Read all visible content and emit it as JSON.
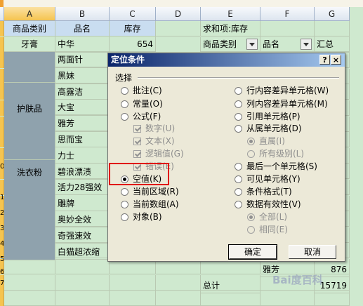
{
  "columns": [
    "A",
    "B",
    "C",
    "D",
    "E",
    "F",
    "G"
  ],
  "row_numbers": [
    "0",
    "1",
    "2",
    "3",
    "4",
    "5",
    "6",
    "7"
  ],
  "headers": {
    "a": "商品类别",
    "b": "品名",
    "c": "库存"
  },
  "rows": {
    "r1": {
      "a": "牙膏",
      "b": "中华",
      "c": "654"
    },
    "b_items": [
      "两面针",
      "黑妹",
      "高露洁",
      "大宝",
      "雅芳",
      "思而宝",
      "力士",
      "碧浪漂渍",
      "活力28强效",
      "雕牌",
      "奥妙全效",
      "奇强速效",
      "白猫超浓缩"
    ],
    "merged_a": [
      "护肤品",
      "洗衣粉"
    ]
  },
  "pivot": {
    "title": "求和项:库存",
    "field1": "商品类别",
    "field2": "品名",
    "total_col": "汇总",
    "row_yafang": "雅芳",
    "row_yafang_val": "876",
    "total_label": "总计",
    "total_val": "15719"
  },
  "dialog": {
    "title": "定位条件",
    "help": "?",
    "close": "×",
    "group": "选择",
    "left_options": [
      {
        "label": "批注(C)",
        "state": "off"
      },
      {
        "label": "常量(O)",
        "state": "off"
      },
      {
        "label": "公式(F)",
        "state": "off"
      },
      {
        "label": "数字(U)",
        "kind": "check"
      },
      {
        "label": "文本(X)",
        "kind": "check"
      },
      {
        "label": "逻辑值(G)",
        "kind": "check"
      },
      {
        "label": "错误(E)",
        "kind": "check"
      },
      {
        "label": "空值(K)",
        "state": "on"
      },
      {
        "label": "当前区域(R)",
        "state": "off"
      },
      {
        "label": "当前数组(A)",
        "state": "off"
      },
      {
        "label": "对象(B)",
        "state": "off"
      }
    ],
    "right_options": [
      {
        "label": "行内容差异单元格(W)",
        "state": "off"
      },
      {
        "label": "列内容差异单元格(M)",
        "state": "off"
      },
      {
        "label": "引用单元格(P)",
        "state": "off"
      },
      {
        "label": "从属单元格(D)",
        "state": "off"
      },
      {
        "label": "直属(I)",
        "state": "dis-on"
      },
      {
        "label": "所有级别(L)",
        "state": "dis"
      },
      {
        "label": "最后一个单元格(S)",
        "state": "off"
      },
      {
        "label": "可见单元格(Y)",
        "state": "off"
      },
      {
        "label": "条件格式(T)",
        "state": "off"
      },
      {
        "label": "数据有效性(V)",
        "state": "off"
      },
      {
        "label": "全部(L)",
        "state": "dis-on"
      },
      {
        "label": "相同(E)",
        "state": "dis"
      }
    ],
    "ok": "确定",
    "cancel": "取消"
  },
  "watermark": "Bai度百科"
}
